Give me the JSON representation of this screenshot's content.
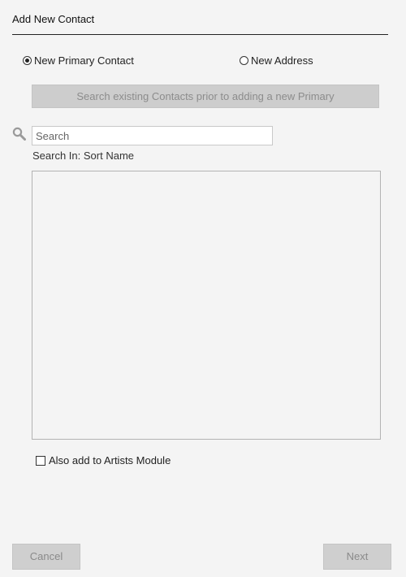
{
  "dialog": {
    "title": "Add New Contact"
  },
  "options": {
    "primary_contact_label": "New Primary Contact",
    "primary_contact_selected": true,
    "new_address_label": "New Address",
    "new_address_selected": false
  },
  "search_existing_button": "Search existing Contacts prior to adding a new Primary",
  "search": {
    "placeholder": "Search",
    "value": "",
    "icon": "search-icon",
    "search_in": "Search In: Sort Name"
  },
  "results": [],
  "artists_module": {
    "label": "Also add to Artists Module",
    "checked": false
  },
  "footer": {
    "cancel_label": "Cancel",
    "next_label": "Next"
  }
}
